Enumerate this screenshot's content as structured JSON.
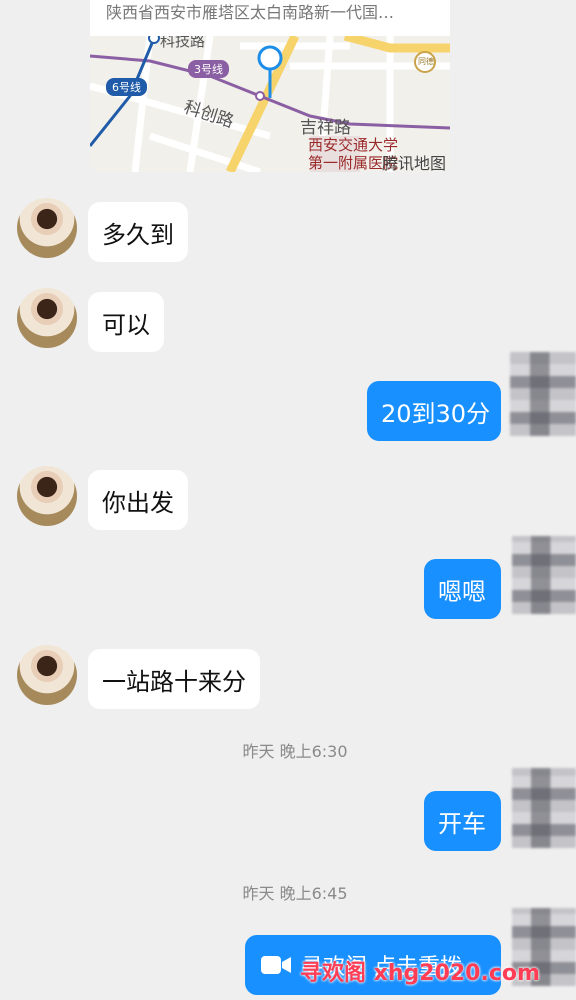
{
  "location": {
    "address": "陕西省西安市雁塔区太白南路新一代国…",
    "map": {
      "station": "科技路",
      "lines": [
        {
          "name": "6号线",
          "color": "#1f5ba8"
        },
        {
          "name": "3号线",
          "color": "#8b5fa3"
        }
      ],
      "roads": [
        "科创路",
        "吉祥路"
      ],
      "poi": [
        "西安交通大学",
        "第一附属医院"
      ],
      "poi_marker": "同德",
      "provider": "腾讯地图"
    }
  },
  "messages": [
    {
      "side": "in",
      "text": "多久到"
    },
    {
      "side": "in",
      "text": "可以"
    },
    {
      "side": "out",
      "text": "20到30分"
    },
    {
      "side": "in",
      "text": "你出发"
    },
    {
      "side": "out",
      "text": "嗯嗯"
    },
    {
      "side": "in",
      "text": "一站路十来分"
    },
    {
      "side": "time",
      "text": "昨天 晚上6:30"
    },
    {
      "side": "out",
      "text": "开车"
    },
    {
      "side": "time",
      "text": "昨天 晚上6:45"
    },
    {
      "side": "out",
      "type": "video-call",
      "text": "寻欢阁 点击重拨"
    }
  ],
  "watermark": "寻欢阁 xhg2020.com",
  "colors": {
    "background": "#efefef",
    "out_bubble": "#1890ff",
    "in_bubble": "#ffffff",
    "watermark": "#ff3d55"
  }
}
